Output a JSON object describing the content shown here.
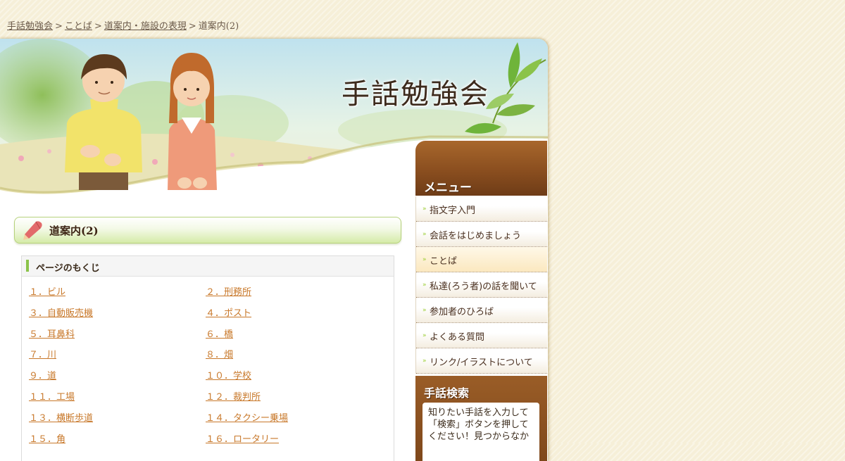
{
  "breadcrumb": {
    "items": [
      "手話勉強会",
      "ことば",
      "道案内・施設の表現"
    ],
    "current": "道案内(2)",
    "separator": ">"
  },
  "header": {
    "site_title": "手話勉強会"
  },
  "page": {
    "heading": "道案内(2)"
  },
  "toc": {
    "heading": "ページのもくじ",
    "items": [
      "１．ビル",
      "２．刑務所",
      "３．自動販売機",
      "４．ポスト",
      "５．耳鼻科",
      "６．橋",
      "７．川",
      "８．畑",
      "９．道",
      "１０．学校",
      "１１．工場",
      "１２．裁判所",
      "１３．横断歩道",
      "１４．タクシー乗場",
      "１５．角",
      "１６．ロータリー"
    ]
  },
  "sidebar": {
    "menu_heading": "メニュー",
    "menu_items": [
      "指文字入門",
      "会話をはじめましょう",
      "ことば",
      "私達(ろう者)の話を聞いて",
      "参加者のひろば",
      "よくある質問",
      "リンク/イラストについて"
    ],
    "active_item": "ことば",
    "search_heading": "手話検索",
    "search_text": "知りたい手話を入力して「検索」ボタンを押してください！見つからなか"
  },
  "colors": {
    "background": "#f6efd8",
    "link": "#c8782a",
    "menu_brown": "#8a4e1f",
    "accent_green": "#8bc34a"
  }
}
